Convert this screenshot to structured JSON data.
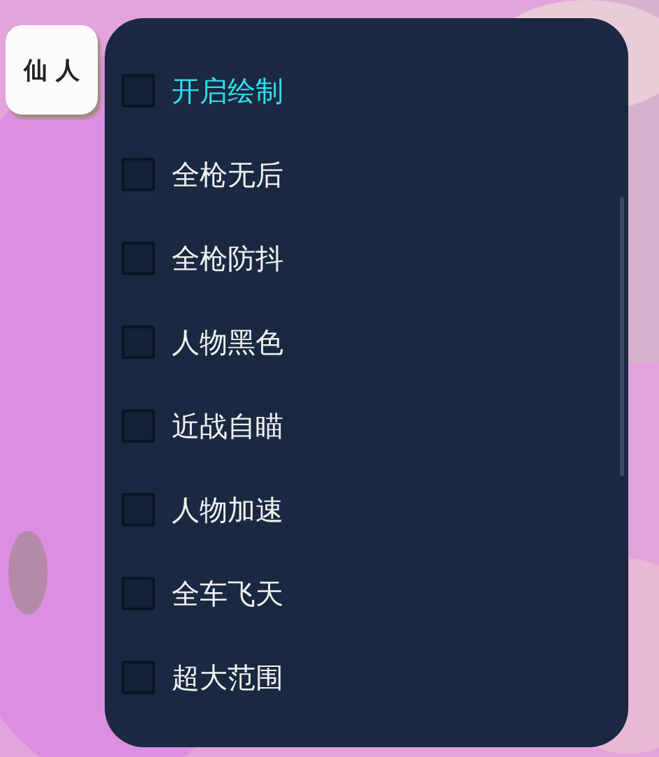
{
  "side_tab": {
    "label": "仙 人"
  },
  "options": [
    {
      "label": "开启绘制",
      "checked": false,
      "selected": true
    },
    {
      "label": "全枪无后",
      "checked": false,
      "selected": false
    },
    {
      "label": "全枪防抖",
      "checked": false,
      "selected": false
    },
    {
      "label": "人物黑色",
      "checked": false,
      "selected": false
    },
    {
      "label": "近战自瞄",
      "checked": false,
      "selected": false
    },
    {
      "label": "人物加速",
      "checked": false,
      "selected": false
    },
    {
      "label": "全车飞天",
      "checked": false,
      "selected": false
    },
    {
      "label": "超大范围",
      "checked": false,
      "selected": false
    }
  ]
}
